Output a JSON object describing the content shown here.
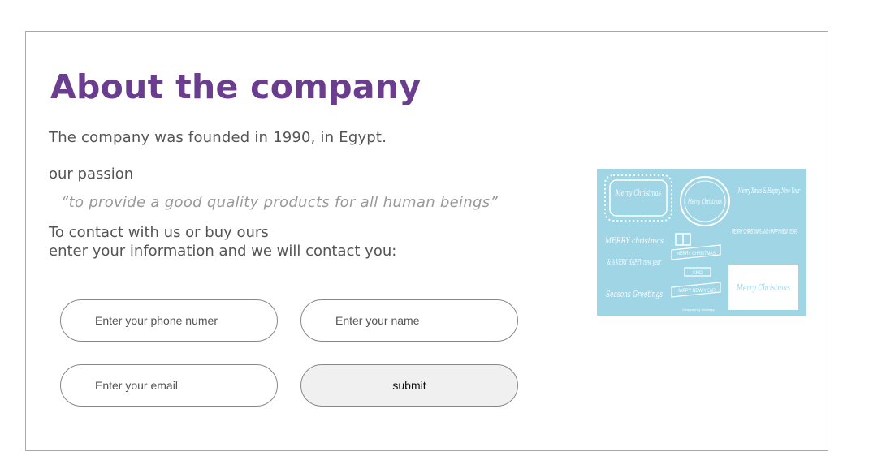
{
  "about": {
    "title": "About the company",
    "founded": "The company was founded in 1990, in Egypt.",
    "passion_label": "our passion",
    "passion_quote": "“to provide a good quality products for all human beings”",
    "contact_line1": "To contact with us or buy ours",
    "contact_line2": "enter your information and we will contact you:"
  },
  "form": {
    "phone_placeholder": "Enter your phone numer",
    "name_placeholder": "Enter your name",
    "email_placeholder": "Enter your email",
    "submit_label": "submit"
  },
  "image": {
    "texts": {
      "merry_christmas_1": "Merry Christmas",
      "merry_christmas_2": "Merry Christmas",
      "merry_xmas_happy_new_year": "Merry Xmas & Happy New Year",
      "merry_christmas_3": "MERRY christmas",
      "merry_christmas_and_happy_new_year": "MERRY CHRISTMAS AND HAPPY NEW YEAR",
      "a_very_happy_new_year": "& A VERY HAPPY new year",
      "banner_merry_christmas": "MERRY CHRISTMAS",
      "banner_and": "AND",
      "banner_happy_new_year": "HAPPY NEW YEAR",
      "seasons_greetings": "Seasons Greetings",
      "merry_christmas_4": "Merry Christmas",
      "designed_by": "Designed by Vecteezy"
    },
    "colors": {
      "background": "#9fd5e5",
      "ink": "#ffffff"
    }
  },
  "colors": {
    "title": "#6a3d8f",
    "text": "#555555",
    "quote": "#999999",
    "border": "#a8a8a8"
  }
}
